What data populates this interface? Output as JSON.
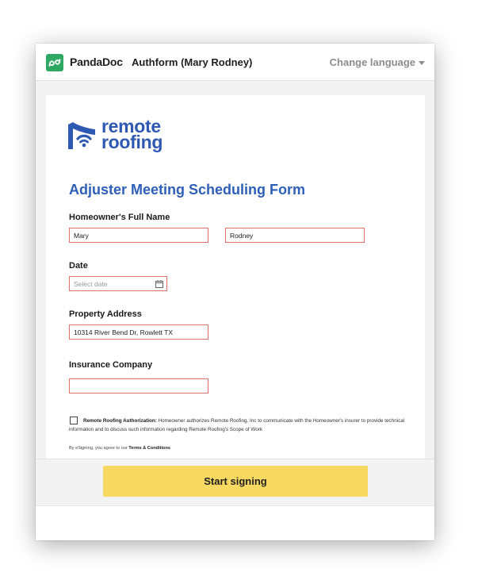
{
  "app": {
    "brand": "PandaDoc",
    "document_title": "Authform (Mary Rodney)",
    "change_language": "Change language",
    "logo_icon": "pandadoc-logo-icon",
    "accent_green": "#2ea862"
  },
  "company": {
    "name_line1": "remote",
    "name_line2": "roofing",
    "logo_icon": "remote-roofing-logo-icon",
    "brand_color": "#2d59b3"
  },
  "form": {
    "title": "Adjuster Meeting Scheduling Form",
    "full_name": {
      "label": "Homeowner's Full Name",
      "first": "Mary",
      "last": "Rodney"
    },
    "date": {
      "label": "Date",
      "placeholder": "Select date",
      "icon": "calendar-icon"
    },
    "property_address": {
      "label": "Property Address",
      "value": "10314 River Bend Dr, Rowlett TX"
    },
    "insurance_company": {
      "label": "Insurance Company",
      "value": ""
    },
    "authorization": {
      "title": "Remote Roofing Authorization:",
      "text": "Homeowner authorizes Remote Roofing, Inc to communicate with the Homeowner's insurer to provide technical information and to discuss such information regarding Remote Roofing's Scope of Work",
      "checked": false
    },
    "esign_prefix": "By eSigning, you agree to our",
    "terms_link": "Terms & Conditions"
  },
  "footer": {
    "start_signing": "Start signing",
    "button_color": "#f7d860"
  }
}
